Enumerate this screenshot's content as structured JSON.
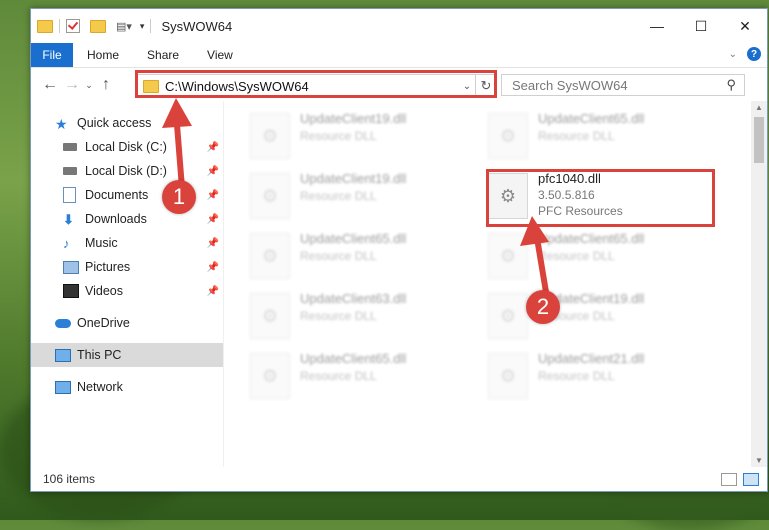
{
  "window": {
    "title": "SysWOW64"
  },
  "ribbon": {
    "tabs": [
      "File",
      "Home",
      "Share",
      "View"
    ]
  },
  "address": {
    "path": "C:\\Windows\\SysWOW64"
  },
  "search": {
    "placeholder": "Search SysWOW64"
  },
  "sidebar": {
    "items": [
      {
        "label": "Quick access",
        "icon": "star-icon"
      },
      {
        "label": "Local Disk (C:)",
        "icon": "disk-icon",
        "pinned": true
      },
      {
        "label": "Local Disk (D:)",
        "icon": "disk-icon",
        "pinned": true
      },
      {
        "label": "Documents",
        "icon": "document-icon",
        "pinned": true
      },
      {
        "label": "Downloads",
        "icon": "download-icon",
        "pinned": true
      },
      {
        "label": "Music",
        "icon": "music-icon",
        "pinned": true
      },
      {
        "label": "Pictures",
        "icon": "pictures-icon",
        "pinned": true
      },
      {
        "label": "Videos",
        "icon": "video-icon",
        "pinned": true
      },
      {
        "label": "OneDrive",
        "icon": "cloud-icon"
      },
      {
        "label": "This PC",
        "icon": "computer-icon",
        "selected": true
      },
      {
        "label": "Network",
        "icon": "network-icon"
      }
    ]
  },
  "files": [
    {
      "name": "UpdateClient19.dll",
      "sub": "Resource DLL"
    },
    {
      "name": "UpdateClient65.dll",
      "sub": "Resource DLL"
    },
    {
      "name": "UpdateClient19.dll",
      "sub": "Resource DLL"
    },
    {
      "name": "pfc1040.dll",
      "sub": "3.50.5.816",
      "sub2": "PFC Resources"
    },
    {
      "name": "UpdateClient65.dll",
      "sub": "Resource DLL"
    },
    {
      "name": "UpdateClient65.dll",
      "sub": "Resource DLL"
    },
    {
      "name": "UpdateClient63.dll",
      "sub": "Resource DLL"
    },
    {
      "name": "UpdateClient19.dll",
      "sub": "Resource DLL"
    },
    {
      "name": "UpdateClient65.dll",
      "sub": "Resource DLL"
    },
    {
      "name": "UpdateClient21.dll",
      "sub": "Resource DLL"
    }
  ],
  "status": {
    "count": "106 items"
  },
  "annotations": {
    "one": "1",
    "two": "2"
  },
  "colors": {
    "accent": "#1a6fce",
    "highlight": "#d9433c"
  }
}
